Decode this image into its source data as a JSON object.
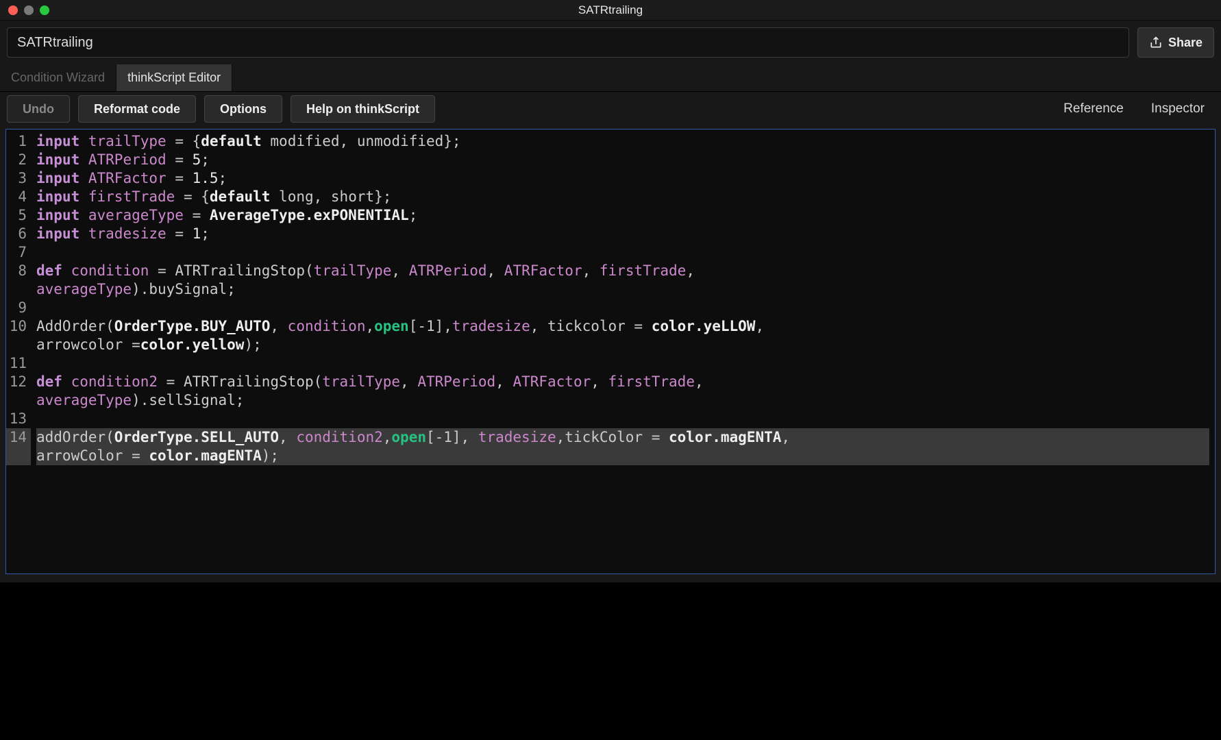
{
  "window": {
    "title": "SATRtrailing"
  },
  "name_field": {
    "value": "SATRtrailing"
  },
  "share_button": {
    "label": "Share"
  },
  "tabs": {
    "condition_wizard": "Condition Wizard",
    "thinkscript_editor": "thinkScript Editor"
  },
  "toolbar": {
    "undo": "Undo",
    "reformat": "Reformat code",
    "options": "Options",
    "help": "Help on thinkScript",
    "reference": "Reference",
    "inspector": "Inspector"
  },
  "code": {
    "line_numbers": [
      "1",
      "2",
      "3",
      "4",
      "5",
      "6",
      "7",
      "8",
      "9",
      "10",
      "11",
      "12",
      "13",
      "14"
    ],
    "lines": [
      [
        {
          "c": "t-kw",
          "t": "input"
        },
        {
          "c": "t-p",
          "t": " "
        },
        {
          "c": "t-id",
          "t": "trailType"
        },
        {
          "c": "t-p",
          "t": " = {"
        },
        {
          "c": "t-b",
          "t": "default"
        },
        {
          "c": "t-p",
          "t": " modified, unmodified};"
        }
      ],
      [
        {
          "c": "t-kw",
          "t": "input"
        },
        {
          "c": "t-p",
          "t": " "
        },
        {
          "c": "t-id",
          "t": "ATRPeriod"
        },
        {
          "c": "t-p",
          "t": " = "
        },
        {
          "c": "t-num",
          "t": "5"
        },
        {
          "c": "t-p",
          "t": ";"
        }
      ],
      [
        {
          "c": "t-kw",
          "t": "input"
        },
        {
          "c": "t-p",
          "t": " "
        },
        {
          "c": "t-id",
          "t": "ATRFactor"
        },
        {
          "c": "t-p",
          "t": " = "
        },
        {
          "c": "t-num",
          "t": "1.5"
        },
        {
          "c": "t-p",
          "t": ";"
        }
      ],
      [
        {
          "c": "t-kw",
          "t": "input"
        },
        {
          "c": "t-p",
          "t": " "
        },
        {
          "c": "t-id",
          "t": "firstTrade"
        },
        {
          "c": "t-p",
          "t": " = {"
        },
        {
          "c": "t-b",
          "t": "default"
        },
        {
          "c": "t-p",
          "t": " long, short};"
        }
      ],
      [
        {
          "c": "t-kw",
          "t": "input"
        },
        {
          "c": "t-p",
          "t": " "
        },
        {
          "c": "t-id",
          "t": "averageType"
        },
        {
          "c": "t-p",
          "t": " = "
        },
        {
          "c": "t-b",
          "t": "AverageType.exPONENTIAL"
        },
        {
          "c": "t-p",
          "t": ";"
        }
      ],
      [
        {
          "c": "t-kw",
          "t": "input"
        },
        {
          "c": "t-p",
          "t": " "
        },
        {
          "c": "t-id",
          "t": "tradesize"
        },
        {
          "c": "t-p",
          "t": " = "
        },
        {
          "c": "t-num",
          "t": "1"
        },
        {
          "c": "t-p",
          "t": ";"
        }
      ],
      [],
      [
        {
          "c": "t-kw",
          "t": "def"
        },
        {
          "c": "t-p",
          "t": " "
        },
        {
          "c": "t-id",
          "t": "condition"
        },
        {
          "c": "t-p",
          "t": " = ATRTrailingStop("
        },
        {
          "c": "t-id",
          "t": "trailType"
        },
        {
          "c": "t-p",
          "t": ", "
        },
        {
          "c": "t-id",
          "t": "ATRPeriod"
        },
        {
          "c": "t-p",
          "t": ", "
        },
        {
          "c": "t-id",
          "t": "ATRFactor"
        },
        {
          "c": "t-p",
          "t": ", "
        },
        {
          "c": "t-id",
          "t": "firstTrade"
        },
        {
          "c": "t-p",
          "t": ", "
        }
      ],
      [
        {
          "c": "t-id",
          "t": "averageType"
        },
        {
          "c": "t-p",
          "t": ").buySignal;"
        }
      ],
      [],
      [
        {
          "c": "t-p",
          "t": "AddOrder("
        },
        {
          "c": "t-b",
          "t": "OrderType.BUY_AUTO"
        },
        {
          "c": "t-p",
          "t": ", "
        },
        {
          "c": "t-id",
          "t": "condition"
        },
        {
          "c": "t-p",
          "t": ","
        },
        {
          "c": "t-gr",
          "t": "open"
        },
        {
          "c": "t-p",
          "t": "[-1],"
        },
        {
          "c": "t-id",
          "t": "tradesize"
        },
        {
          "c": "t-p",
          "t": ", tickcolor = "
        },
        {
          "c": "t-b",
          "t": "color.yeLLOW"
        },
        {
          "c": "t-p",
          "t": ", "
        }
      ],
      [
        {
          "c": "t-p",
          "t": "arrowcolor ="
        },
        {
          "c": "t-b",
          "t": "color.yellow"
        },
        {
          "c": "t-p",
          "t": ");"
        }
      ],
      [],
      [
        {
          "c": "t-kw",
          "t": "def"
        },
        {
          "c": "t-p",
          "t": " "
        },
        {
          "c": "t-id",
          "t": "condition2"
        },
        {
          "c": "t-p",
          "t": " = ATRTrailingStop("
        },
        {
          "c": "t-id",
          "t": "trailType"
        },
        {
          "c": "t-p",
          "t": ", "
        },
        {
          "c": "t-id",
          "t": "ATRPeriod"
        },
        {
          "c": "t-p",
          "t": ", "
        },
        {
          "c": "t-id",
          "t": "ATRFactor"
        },
        {
          "c": "t-p",
          "t": ", "
        },
        {
          "c": "t-id",
          "t": "firstTrade"
        },
        {
          "c": "t-p",
          "t": ", "
        }
      ],
      [
        {
          "c": "t-id",
          "t": "averageType"
        },
        {
          "c": "t-p",
          "t": ").sellSignal;"
        }
      ],
      [],
      [
        {
          "c": "t-p",
          "t": "addOrder("
        },
        {
          "c": "t-b",
          "t": "OrderType.SELL_AUTO"
        },
        {
          "c": "t-p",
          "t": ", "
        },
        {
          "c": "t-id",
          "t": "condition2"
        },
        {
          "c": "t-p",
          "t": ","
        },
        {
          "c": "t-gr",
          "t": "open"
        },
        {
          "c": "t-p",
          "t": "[-1], "
        },
        {
          "c": "t-id",
          "t": "tradesize"
        },
        {
          "c": "t-p",
          "t": ",tickColor = "
        },
        {
          "c": "t-b",
          "t": "color.magENTA"
        },
        {
          "c": "t-p",
          "t": ", "
        }
      ],
      [
        {
          "c": "t-p",
          "t": "arrowColor = "
        },
        {
          "c": "t-b",
          "t": "color.magENTA"
        },
        {
          "c": "t-p",
          "t": ");"
        }
      ]
    ],
    "highlight_display_rows": [
      16,
      17
    ]
  }
}
